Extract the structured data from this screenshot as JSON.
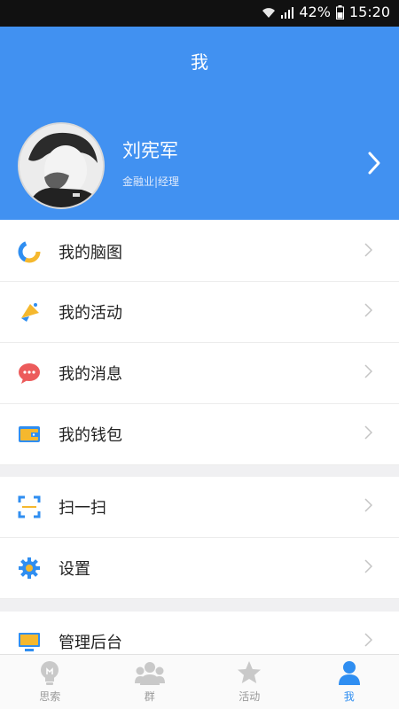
{
  "status_bar": {
    "battery": "42%",
    "time": "15:20"
  },
  "header": {
    "title": "我"
  },
  "profile": {
    "name": "刘宪军",
    "subtitle": "金融业|经理"
  },
  "menu": [
    {
      "label": "我的脑图",
      "icon": "mindmap-icon"
    },
    {
      "label": "我的活动",
      "icon": "megaphone-icon"
    },
    {
      "label": "我的消息",
      "icon": "message-icon"
    },
    {
      "label": "我的钱包",
      "icon": "wallet-icon"
    },
    {
      "label": "扫一扫",
      "icon": "scan-icon"
    },
    {
      "label": "设置",
      "icon": "gear-icon"
    },
    {
      "label": "管理后台",
      "icon": "monitor-icon"
    }
  ],
  "tabs": [
    {
      "label": "思索",
      "icon": "lightbulb-icon"
    },
    {
      "label": "群",
      "icon": "group-icon"
    },
    {
      "label": "活动",
      "icon": "star-icon"
    },
    {
      "label": "我",
      "icon": "user-icon",
      "active": true
    }
  ],
  "colors": {
    "accent": "#4191f1",
    "active_tab": "#2f8ef1"
  }
}
